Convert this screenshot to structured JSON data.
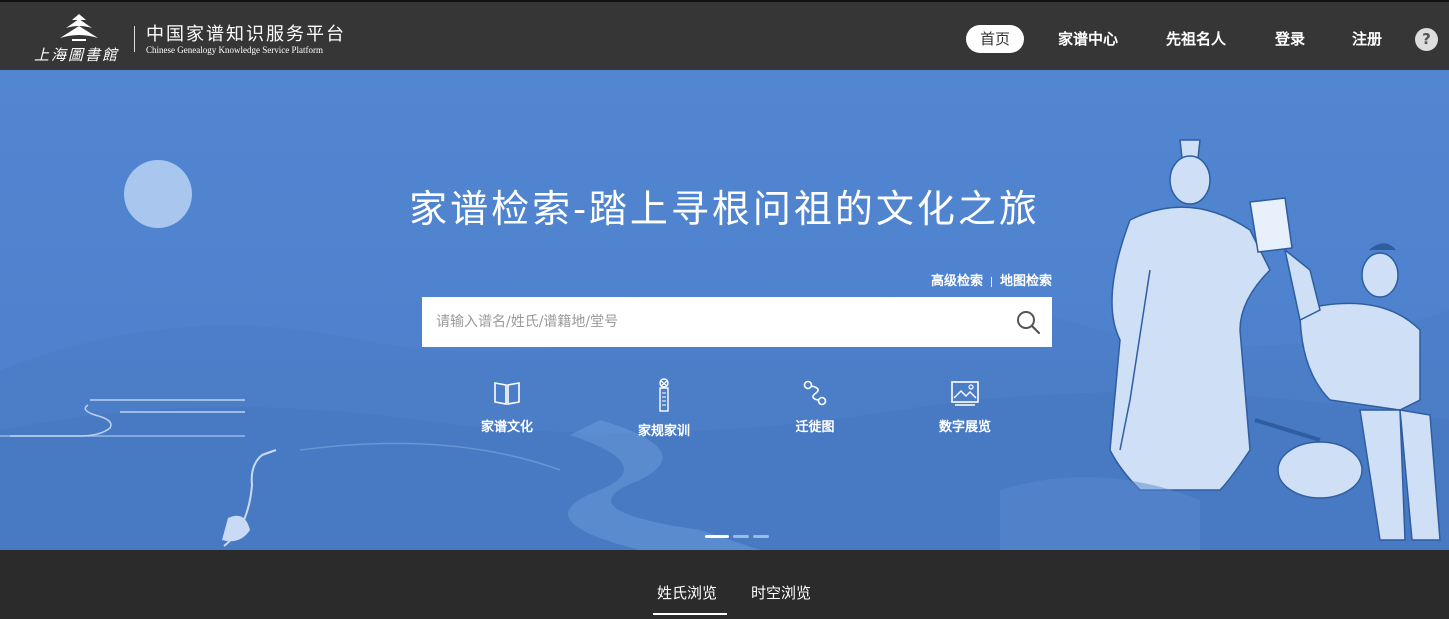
{
  "header": {
    "library_name": "上海圖書館",
    "site_title": "中国家谱知识服务平台",
    "site_subtitle": "Chinese Genealogy Knowledge Service Platform",
    "nav": [
      {
        "label": "首页",
        "active": true
      },
      {
        "label": "家谱中心",
        "active": false
      },
      {
        "label": "先祖名人",
        "active": false
      },
      {
        "label": "登录",
        "active": false
      },
      {
        "label": "注册",
        "active": false
      }
    ],
    "help_label": "?"
  },
  "banner": {
    "headline": "家谱检索-踏上寻根问祖的文化之旅",
    "search_links": [
      "高级检索",
      "地图检索"
    ],
    "search_placeholder": "请输入谱名/姓氏/谱籍地/堂号",
    "quick_links": [
      {
        "label": "家谱文化",
        "icon": "book-icon"
      },
      {
        "label": "家规家训",
        "icon": "scroll-icon"
      },
      {
        "label": "迁徙图",
        "icon": "route-icon"
      },
      {
        "label": "数字展览",
        "icon": "picture-icon"
      }
    ],
    "carousel_active": 0
  },
  "tabs": [
    {
      "label": "姓氏浏览",
      "active": true
    },
    {
      "label": "时空浏览",
      "active": false
    }
  ],
  "colors": {
    "header_bg": "#363636",
    "banner_blue": "#4f83cf",
    "footer_bg": "#2b2b2b"
  }
}
